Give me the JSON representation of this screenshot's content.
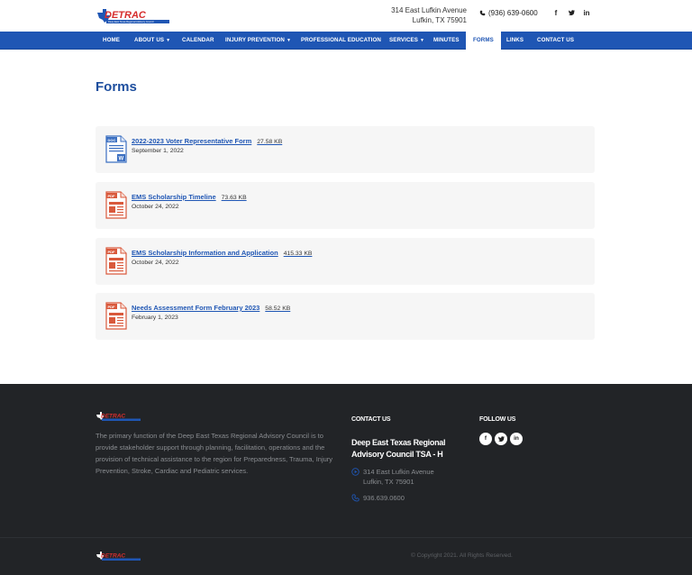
{
  "header": {
    "logo_text": "DETRAC",
    "logo_tagline": "Deep East Texas Regional Advisory Council",
    "address_line1": "314 East Lufkin Avenue",
    "address_line2": "Lufkin, TX 75901",
    "phone": "(936) 639-0600",
    "social": [
      {
        "icon": "facebook-icon",
        "glyph": "f"
      },
      {
        "icon": "twitter-icon",
        "glyph": "✶"
      },
      {
        "icon": "linkedin-icon",
        "glyph": "in"
      }
    ]
  },
  "nav": {
    "items": [
      {
        "label": "Home",
        "dropdown": false
      },
      {
        "label": "About Us",
        "dropdown": true
      },
      {
        "label": "Calendar",
        "dropdown": false
      },
      {
        "label": "Injury Prevention",
        "dropdown": true
      },
      {
        "label": "Professional Education",
        "dropdown": false
      },
      {
        "label": "Services",
        "dropdown": true
      },
      {
        "label": "Minutes",
        "dropdown": false
      },
      {
        "label": "Forms",
        "dropdown": false,
        "active": true
      },
      {
        "label": "Links",
        "dropdown": false
      },
      {
        "label": "Contact Us",
        "dropdown": false
      }
    ]
  },
  "main": {
    "title": "Forms",
    "forms": [
      {
        "name": "2022-2023 Voter Representative Form",
        "size": "27.58 KB",
        "date": "September 1, 2022",
        "type": "DOC",
        "type_color": "#3b6fc1"
      },
      {
        "name": "EMS Scholarship Timeline",
        "size": "73.63 KB",
        "date": "October 24, 2022",
        "type": "PDF",
        "type_color": "#d9593c"
      },
      {
        "name": "EMS Scholarship Information and Application",
        "size": "415.33 KB",
        "date": "October 24, 2022",
        "type": "PDF",
        "type_color": "#d9593c"
      },
      {
        "name": "Needs Assessment Form February 2023",
        "size": "58.52 KB",
        "date": "February 1, 2023",
        "type": "PDF",
        "type_color": "#d9593c"
      }
    ]
  },
  "footer": {
    "description": "The primary function of the Deep East Texas Regional Advisory Council is to provide stakeholder support through planning, facilitation, operations and the provision of technical assistance to the region for Preparedness, Trauma, Injury Prevention, Stroke, Cardiac and Pediatric services.",
    "contact_heading": "CONTACT US",
    "org_name": "Deep East Texas Regional Advisory Council TSA - H",
    "address_line1": "314 East Lufkin Avenue",
    "address_line2": "Lufkin, TX 75901",
    "phone": "936.639.0600",
    "follow_heading": "FOLLOW US",
    "copyright": "© Copyright 2021. All Rights Reserved."
  },
  "colors": {
    "nav_blue": "#1f56b4",
    "title_blue": "#1d4e9e",
    "footer_bg": "#222427",
    "logo_red": "#d62e2e"
  }
}
